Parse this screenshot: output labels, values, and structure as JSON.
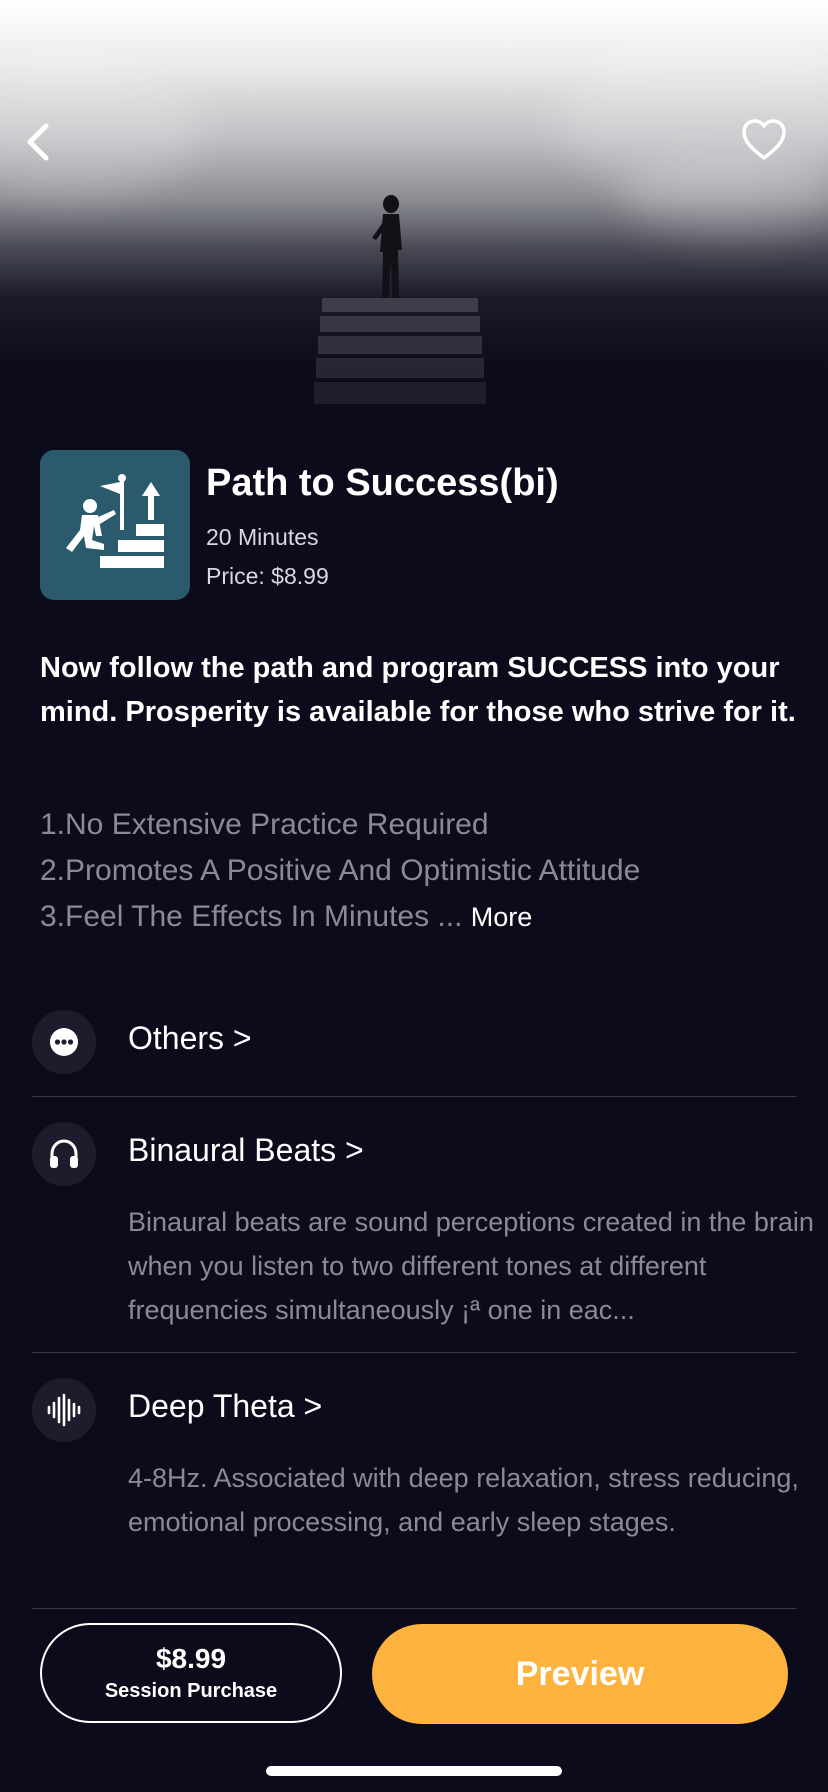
{
  "header": {
    "back_icon": "chevron-left-icon",
    "favorite_icon": "heart-outline-icon"
  },
  "session": {
    "title": "Path to Success(bi)",
    "duration": "20 Minutes",
    "price": "Price: $8.99",
    "icon": "stairs-flag-icon",
    "icon_bg_color": "#2b5a6c"
  },
  "description": {
    "headline": "Now follow the path and program SUCCESS into your mind. Prosperity is available for those who strive for it.",
    "benefits": [
      "1.No Extensive Practice Required",
      "2.Promotes A Positive And Optimistic Attitude",
      "3.Feel The Effects In Minutes ..."
    ],
    "more_label": "More"
  },
  "features": [
    {
      "name": "Others >",
      "icon": "more-dots-icon",
      "description": ""
    },
    {
      "name": "Binaural Beats >",
      "icon": "headphones-icon",
      "description": "Binaural beats are sound perceptions created in the brain when you listen to two different tones at different frequencies simultaneously ¡ª one in eac..."
    },
    {
      "name": "Deep Theta >",
      "icon": "sound-wave-icon",
      "description": "4-8Hz. Associated with deep relaxation, stress reducing, emotional processing, and early sleep stages."
    }
  ],
  "footer": {
    "purchase_price": "$8.99",
    "purchase_label": "Session Purchase",
    "preview_label": "Preview",
    "accent_color": "#fdb33d"
  }
}
